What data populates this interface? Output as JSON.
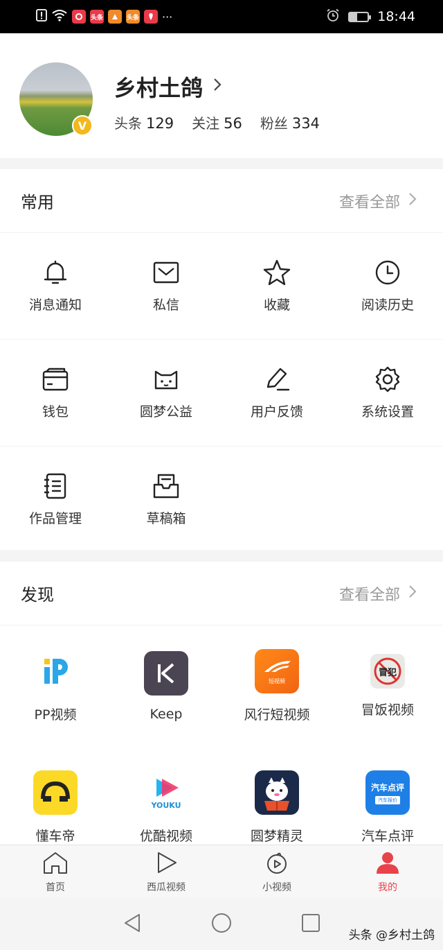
{
  "status_bar": {
    "time": "18:44",
    "app_icons": [
      {
        "text": "",
        "color": "#e93a4a"
      },
      {
        "text": "头条",
        "color": "#e93a4a"
      },
      {
        "text": "",
        "color": "#f08a2a"
      },
      {
        "text": "头条",
        "color": "#f08a2a"
      },
      {
        "text": "",
        "color": "#e93a4a"
      }
    ],
    "more": "···"
  },
  "profile": {
    "name": "乡村土鸽",
    "badge": "V",
    "stats": [
      {
        "label": "头条",
        "value": "129"
      },
      {
        "label": "关注",
        "value": "56"
      },
      {
        "label": "粉丝",
        "value": "334"
      }
    ]
  },
  "common": {
    "title": "常用",
    "more_label": "查看全部",
    "items": [
      {
        "label": "消息通知",
        "icon": "bell-icon"
      },
      {
        "label": "私信",
        "icon": "envelope-icon"
      },
      {
        "label": "收藏",
        "icon": "star-icon"
      },
      {
        "label": "阅读历史",
        "icon": "clock-icon"
      },
      {
        "label": "钱包",
        "icon": "wallet-icon"
      },
      {
        "label": "圆梦公益",
        "icon": "cat-face-icon"
      },
      {
        "label": "用户反馈",
        "icon": "pencil-icon"
      },
      {
        "label": "系统设置",
        "icon": "gear-icon"
      },
      {
        "label": "作品管理",
        "icon": "notebook-icon"
      },
      {
        "label": "草稿箱",
        "icon": "draft-box-icon"
      }
    ]
  },
  "discover": {
    "title": "发现",
    "more_label": "查看全部",
    "apps": [
      {
        "label": "PP视频",
        "icon": "pp-video-icon"
      },
      {
        "label": "Keep",
        "icon": "keep-icon"
      },
      {
        "label": "风行短视频",
        "icon": "fengxing-icon",
        "icon_text": "短视频"
      },
      {
        "label": "冒饭视频",
        "icon": "maofan-icon",
        "icon_text": "冒犯"
      },
      {
        "label": "懂车帝",
        "icon": "dongchedi-icon"
      },
      {
        "label": "优酷视频",
        "icon": "youku-icon",
        "icon_text": "YOUKU"
      },
      {
        "label": "圆梦精灵",
        "icon": "yuanmeng-icon"
      },
      {
        "label": "汽车点评",
        "icon": "qichedianping-icon",
        "icon_text": "汽车点评",
        "icon_subtext": "汽车报价"
      }
    ]
  },
  "tabbar": {
    "tabs": [
      {
        "label": "首页",
        "icon": "home-icon"
      },
      {
        "label": "西瓜视频",
        "icon": "play-icon"
      },
      {
        "label": "小视频",
        "icon": "short-video-icon"
      },
      {
        "label": "我的",
        "icon": "person-icon",
        "active": true
      }
    ]
  },
  "watermark": "头条 @乡村土鸽"
}
